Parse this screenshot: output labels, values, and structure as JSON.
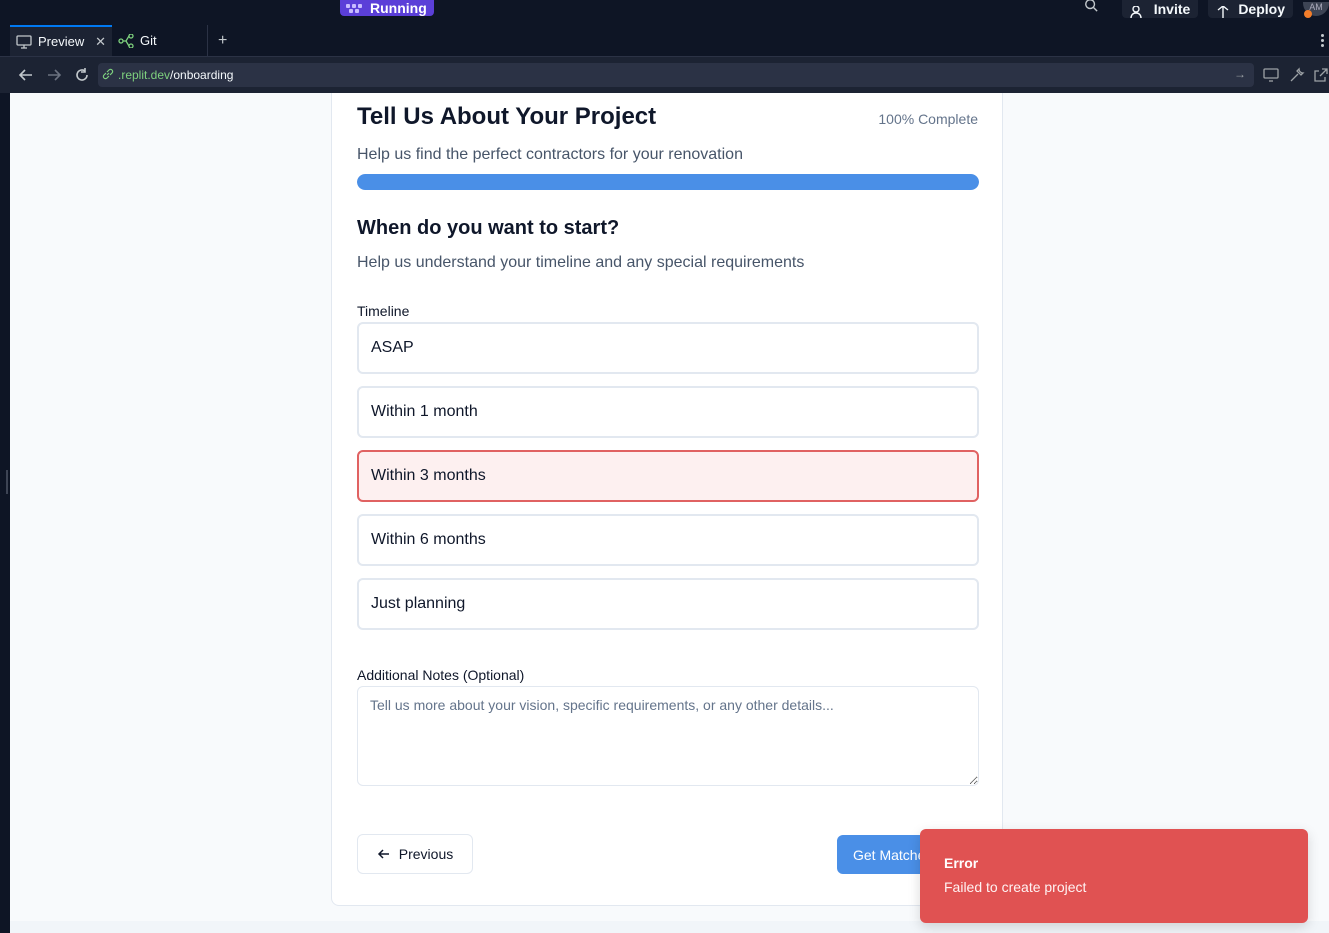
{
  "ide": {
    "status_label": "Running",
    "invite_label": "Invite",
    "deploy_label": "Deploy",
    "avatar_initials": "AM",
    "tabs": [
      {
        "label": "Preview",
        "icon": "monitor-icon"
      },
      {
        "label": "Git",
        "icon": "git-branch-icon"
      }
    ],
    "url_host": ".replit.dev",
    "url_path": "/onboarding"
  },
  "form": {
    "title": "Tell Us About Your Project",
    "progress_label": "100% Complete",
    "progress_percent": 100,
    "subtitle": "Help us find the perfect contractors for your renovation",
    "question_title": "When do you want to start?",
    "question_subtitle": "Help us understand your timeline and any special requirements",
    "timeline_label": "Timeline",
    "options": [
      {
        "label": "ASAP",
        "selected": false
      },
      {
        "label": "Within 1 month",
        "selected": false
      },
      {
        "label": "Within 3 months",
        "selected": true
      },
      {
        "label": "Within 6 months",
        "selected": false
      },
      {
        "label": "Just planning",
        "selected": false
      }
    ],
    "notes_label": "Additional Notes (Optional)",
    "notes_placeholder": "Tell us more about your vision, specific requirements, or any other details...",
    "notes_value": "",
    "previous_label": "Previous",
    "next_label": "Get Matched"
  },
  "toast": {
    "title": "Error",
    "description": "Failed to create project",
    "color": "#e05252"
  }
}
